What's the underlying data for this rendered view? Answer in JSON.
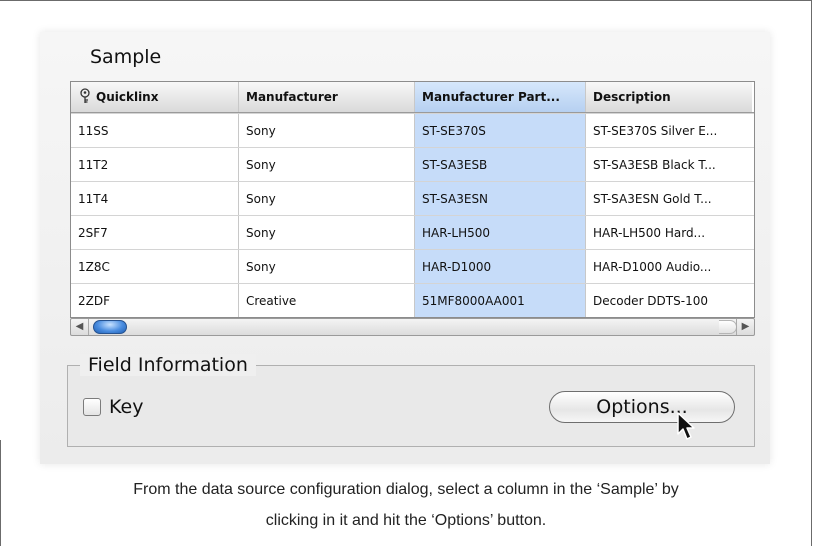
{
  "sample": {
    "title": "Sample",
    "columns": [
      "Quicklinx",
      "Manufacturer",
      "Manufacturer Part...",
      "Description"
    ],
    "selected_column": 2,
    "rows": [
      [
        "11SS",
        "Sony",
        "ST-SE370S",
        "ST-SE370S Silver E..."
      ],
      [
        "11T2",
        "Sony",
        "ST-SA3ESB",
        "ST-SA3ESB Black T..."
      ],
      [
        "11T4",
        "Sony",
        "ST-SA3ESN",
        "ST-SA3ESN Gold T..."
      ],
      [
        "2SF7",
        "Sony",
        "HAR-LH500",
        "HAR-LH500 Hard..."
      ],
      [
        "1Z8C",
        "Sony",
        "HAR-D1000",
        "HAR-D1000 Audio..."
      ],
      [
        "2ZDF",
        "Creative",
        "51MF8000AA001",
        "Decoder DDTS-100"
      ]
    ]
  },
  "field_info": {
    "legend": "Field Information",
    "key_label": "Key",
    "key_checked": false,
    "options_label": "Options..."
  },
  "caption": {
    "line1": "From the data source configuration dialog, select a column in the ‘Sample’ by",
    "line2": "clicking in it and hit the ‘Options’ button."
  },
  "colors": {
    "selected_column": "#c6dcf9",
    "scroll_thumb": "#4a8de0"
  },
  "icons": [
    "key-icon",
    "scroll-left-arrow-icon",
    "scroll-right-arrow-icon",
    "mouse-pointer-icon"
  ]
}
